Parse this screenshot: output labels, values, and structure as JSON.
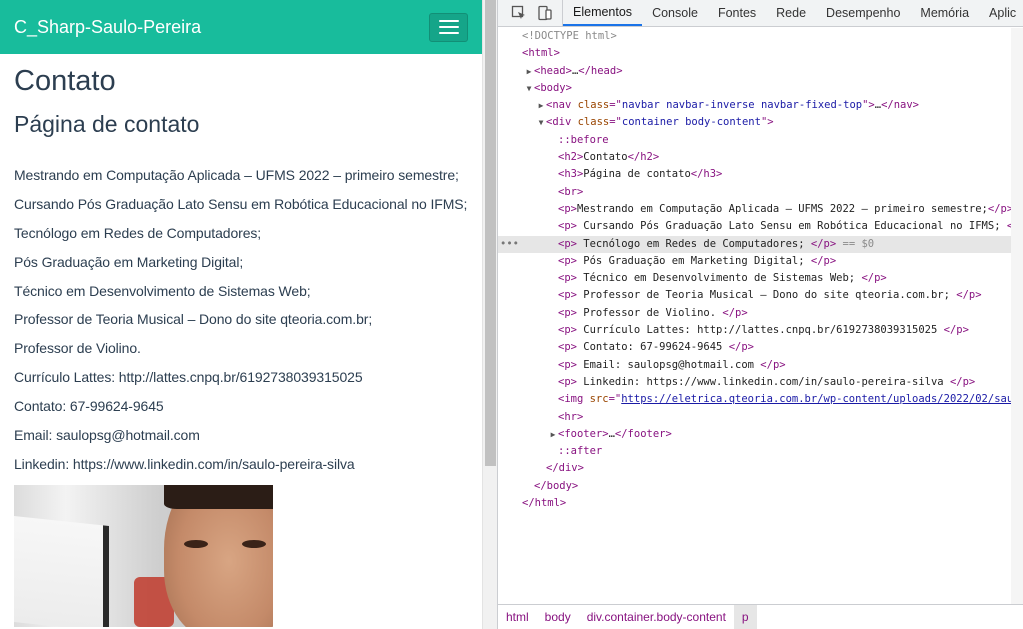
{
  "page": {
    "brand": "C_Sharp-Saulo-Pereira",
    "heading": "Contato",
    "subheading": "Página de contato",
    "paragraphs": [
      "Mestrando em Computação Aplicada – UFMS 2022 – primeiro semestre;",
      "Cursando Pós Graduação Lato Sensu em Robótica Educacional no IFMS;",
      "Tecnólogo em Redes de Computadores;",
      "Pós Graduação em Marketing Digital;",
      "Técnico em Desenvolvimento de Sistemas Web;",
      "Professor de Teoria Musical – Dono do site qteoria.com.br;",
      "Professor de Violino.",
      "Currículo Lattes: http://lattes.cnpq.br/6192738039315025",
      "Contato: 67-99624-9645",
      "Email: saulopsg@hotmail.com",
      "Linkedin: https://www.linkedin.com/in/saulo-pereira-silva"
    ]
  },
  "devtools": {
    "tabs": [
      "Elementos",
      "Console",
      "Fontes",
      "Rede",
      "Desempenho",
      "Memória",
      "Aplic"
    ],
    "active_tab": "Elementos",
    "breadcrumb": [
      "html",
      "body",
      "div.container.body-content",
      "p"
    ],
    "dom_lines": [
      {
        "indent": 0,
        "arrow": "",
        "parts": [
          [
            "comment",
            "<!DOCTYPE html>"
          ]
        ]
      },
      {
        "indent": 0,
        "arrow": "",
        "parts": [
          [
            "tag",
            "<html>"
          ]
        ]
      },
      {
        "indent": 1,
        "arrow": "▶",
        "parts": [
          [
            "tag",
            "<head>"
          ],
          [
            "text",
            "…"
          ],
          [
            "tag",
            "</head>"
          ]
        ]
      },
      {
        "indent": 1,
        "arrow": "▼",
        "parts": [
          [
            "tag",
            "<body>"
          ]
        ]
      },
      {
        "indent": 2,
        "arrow": "▶",
        "parts": [
          [
            "tag",
            "<nav "
          ],
          [
            "attr",
            "class"
          ],
          [
            "tag",
            "=\""
          ],
          [
            "val",
            "navbar navbar-inverse navbar-fixed-top"
          ],
          [
            "tag",
            "\">"
          ],
          [
            "text",
            "…"
          ],
          [
            "tag",
            "</nav>"
          ]
        ]
      },
      {
        "indent": 2,
        "arrow": "▼",
        "parts": [
          [
            "tag",
            "<div "
          ],
          [
            "attr",
            "class"
          ],
          [
            "tag",
            "=\""
          ],
          [
            "val",
            "container body-content"
          ],
          [
            "tag",
            "\">"
          ]
        ]
      },
      {
        "indent": 3,
        "arrow": "",
        "parts": [
          [
            "pseudo",
            "::before"
          ]
        ]
      },
      {
        "indent": 3,
        "arrow": "",
        "parts": [
          [
            "tag",
            "<h2>"
          ],
          [
            "text",
            "Contato"
          ],
          [
            "tag",
            "</h2>"
          ]
        ]
      },
      {
        "indent": 3,
        "arrow": "",
        "parts": [
          [
            "tag",
            "<h3>"
          ],
          [
            "text",
            "Página de contato"
          ],
          [
            "tag",
            "</h3>"
          ]
        ]
      },
      {
        "indent": 3,
        "arrow": "",
        "parts": [
          [
            "tag",
            "<br>"
          ]
        ]
      },
      {
        "indent": 3,
        "arrow": "",
        "parts": [
          [
            "tag",
            "<p>"
          ],
          [
            "text",
            "Mestrando em Computação Aplicada – UFMS 2022 – primeiro semestre;"
          ],
          [
            "tag",
            "</p>"
          ]
        ]
      },
      {
        "indent": 3,
        "arrow": "",
        "parts": [
          [
            "tag",
            "<p>"
          ],
          [
            "text",
            " Cursando Pós Graduação Lato Sensu em Robótica Educacional no IFMS; "
          ],
          [
            "tag",
            "<"
          ]
        ]
      },
      {
        "indent": 3,
        "arrow": "",
        "selected": true,
        "parts": [
          [
            "tag",
            "<p>"
          ],
          [
            "text",
            " Tecnólogo em Redes de Computadores; "
          ],
          [
            "tag",
            "</p>"
          ],
          [
            "comment",
            " == $0"
          ]
        ]
      },
      {
        "indent": 3,
        "arrow": "",
        "parts": [
          [
            "tag",
            "<p>"
          ],
          [
            "text",
            " Pós Graduação em Marketing Digital; "
          ],
          [
            "tag",
            "</p>"
          ]
        ]
      },
      {
        "indent": 3,
        "arrow": "",
        "parts": [
          [
            "tag",
            "<p>"
          ],
          [
            "text",
            " Técnico em Desenvolvimento de Sistemas Web; "
          ],
          [
            "tag",
            "</p>"
          ]
        ]
      },
      {
        "indent": 3,
        "arrow": "",
        "parts": [
          [
            "tag",
            "<p>"
          ],
          [
            "text",
            " Professor de Teoria Musical – Dono do site qteoria.com.br; "
          ],
          [
            "tag",
            "</p>"
          ]
        ]
      },
      {
        "indent": 3,
        "arrow": "",
        "parts": [
          [
            "tag",
            "<p>"
          ],
          [
            "text",
            " Professor de Violino. "
          ],
          [
            "tag",
            "</p>"
          ]
        ]
      },
      {
        "indent": 3,
        "arrow": "",
        "parts": [
          [
            "tag",
            "<p>"
          ],
          [
            "text",
            " Currículo Lattes: http://lattes.cnpq.br/6192738039315025 "
          ],
          [
            "tag",
            "</p>"
          ]
        ]
      },
      {
        "indent": 3,
        "arrow": "",
        "parts": [
          [
            "tag",
            "<p>"
          ],
          [
            "text",
            " Contato: 67-99624-9645 "
          ],
          [
            "tag",
            "</p>"
          ]
        ]
      },
      {
        "indent": 3,
        "arrow": "",
        "parts": [
          [
            "tag",
            "<p>"
          ],
          [
            "text",
            " Email: saulopsg@hotmail.com "
          ],
          [
            "tag",
            "</p>"
          ]
        ]
      },
      {
        "indent": 3,
        "arrow": "",
        "parts": [
          [
            "tag",
            "<p>"
          ],
          [
            "text",
            " Linkedin: https://www.linkedin.com/in/saulo-pereira-silva "
          ],
          [
            "tag",
            "</p>"
          ]
        ]
      },
      {
        "indent": 3,
        "arrow": "",
        "parts": [
          [
            "tag",
            "<img "
          ],
          [
            "attr",
            "src"
          ],
          [
            "tag",
            "=\""
          ],
          [
            "link",
            "https://eletrica.qteoria.com.br/wp-content/uploads/2022/02/sau"
          ]
        ]
      },
      {
        "indent": 3,
        "arrow": "",
        "parts": [
          [
            "tag",
            "<hr>"
          ]
        ]
      },
      {
        "indent": 3,
        "arrow": "▶",
        "parts": [
          [
            "tag",
            "<footer>"
          ],
          [
            "text",
            "…"
          ],
          [
            "tag",
            "</footer>"
          ]
        ]
      },
      {
        "indent": 3,
        "arrow": "",
        "parts": [
          [
            "pseudo",
            "::after"
          ]
        ]
      },
      {
        "indent": 2,
        "arrow": "",
        "parts": [
          [
            "tag",
            "</div>"
          ]
        ]
      },
      {
        "indent": 1,
        "arrow": "",
        "parts": [
          [
            "tag",
            "</body>"
          ]
        ]
      },
      {
        "indent": 0,
        "arrow": "",
        "parts": [
          [
            "tag",
            "</html>"
          ]
        ]
      }
    ]
  },
  "icons": {
    "inspect": "inspect-element-icon",
    "device": "device-toolbar-icon",
    "menu": "hamburger-menu-icon"
  },
  "colors": {
    "navbar": "#18bc9c",
    "text": "#2c3e50",
    "tag": "#881280",
    "attr": "#994500",
    "value": "#1a1aa6",
    "accent": "#1a73e8"
  }
}
